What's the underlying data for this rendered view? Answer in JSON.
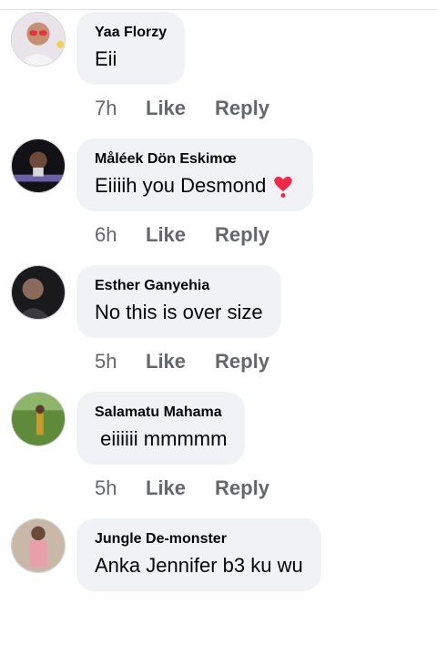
{
  "comments": [
    {
      "author": "Yaa Florzy",
      "text": "Eii",
      "time": "7h",
      "like": "Like",
      "reply": "Reply"
    },
    {
      "author": "Måléek Dön Eskimœ",
      "text": "Eiiiih you Desmond",
      "emoji": "heavy-heart-exclamation",
      "time": "6h",
      "like": "Like",
      "reply": "Reply"
    },
    {
      "author": "Esther Ganyehia",
      "text": "No this is over size",
      "time": "5h",
      "like": "Like",
      "reply": "Reply"
    },
    {
      "author": "Salamatu Mahama",
      "text": " eiiiiii mmmmm",
      "time": "5h",
      "like": "Like",
      "reply": "Reply"
    },
    {
      "author": "Jungle De-monster",
      "text": "Anka Jennifer b3 ku wu"
    }
  ]
}
